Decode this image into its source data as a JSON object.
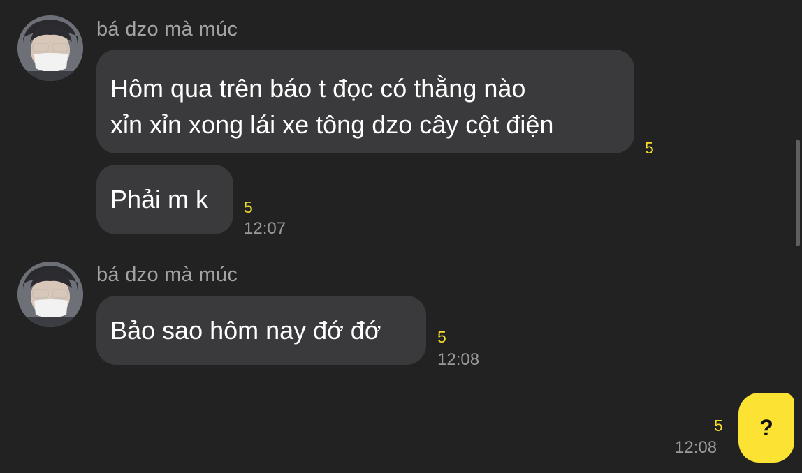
{
  "conversation": {
    "groups": [
      {
        "sender": "bá dzo mà múc",
        "messages": [
          {
            "lines": [
              "Hôm qua trên báo t đọc có thằng nào",
              "xỉn xỉn xong lái xe tông dzo cây cột điện"
            ],
            "unread": "5",
            "time": ""
          },
          {
            "lines": [
              "Phải m k"
            ],
            "unread": "5",
            "time": "12:07"
          }
        ]
      },
      {
        "sender": "bá dzo mà múc",
        "messages": [
          {
            "lines": [
              "Bảo sao hôm nay đớ đớ"
            ],
            "unread": "5",
            "time": "12:08"
          }
        ]
      }
    ],
    "outgoing": {
      "text": "?",
      "unread": "5",
      "time": "12:08"
    }
  },
  "colors": {
    "background": "#222222",
    "incoming_bubble": "#3a3a3c",
    "outgoing_bubble": "#fce333",
    "unread_count": "#f5dd2f"
  },
  "icons": {
    "avatar": "user-avatar-photo"
  }
}
